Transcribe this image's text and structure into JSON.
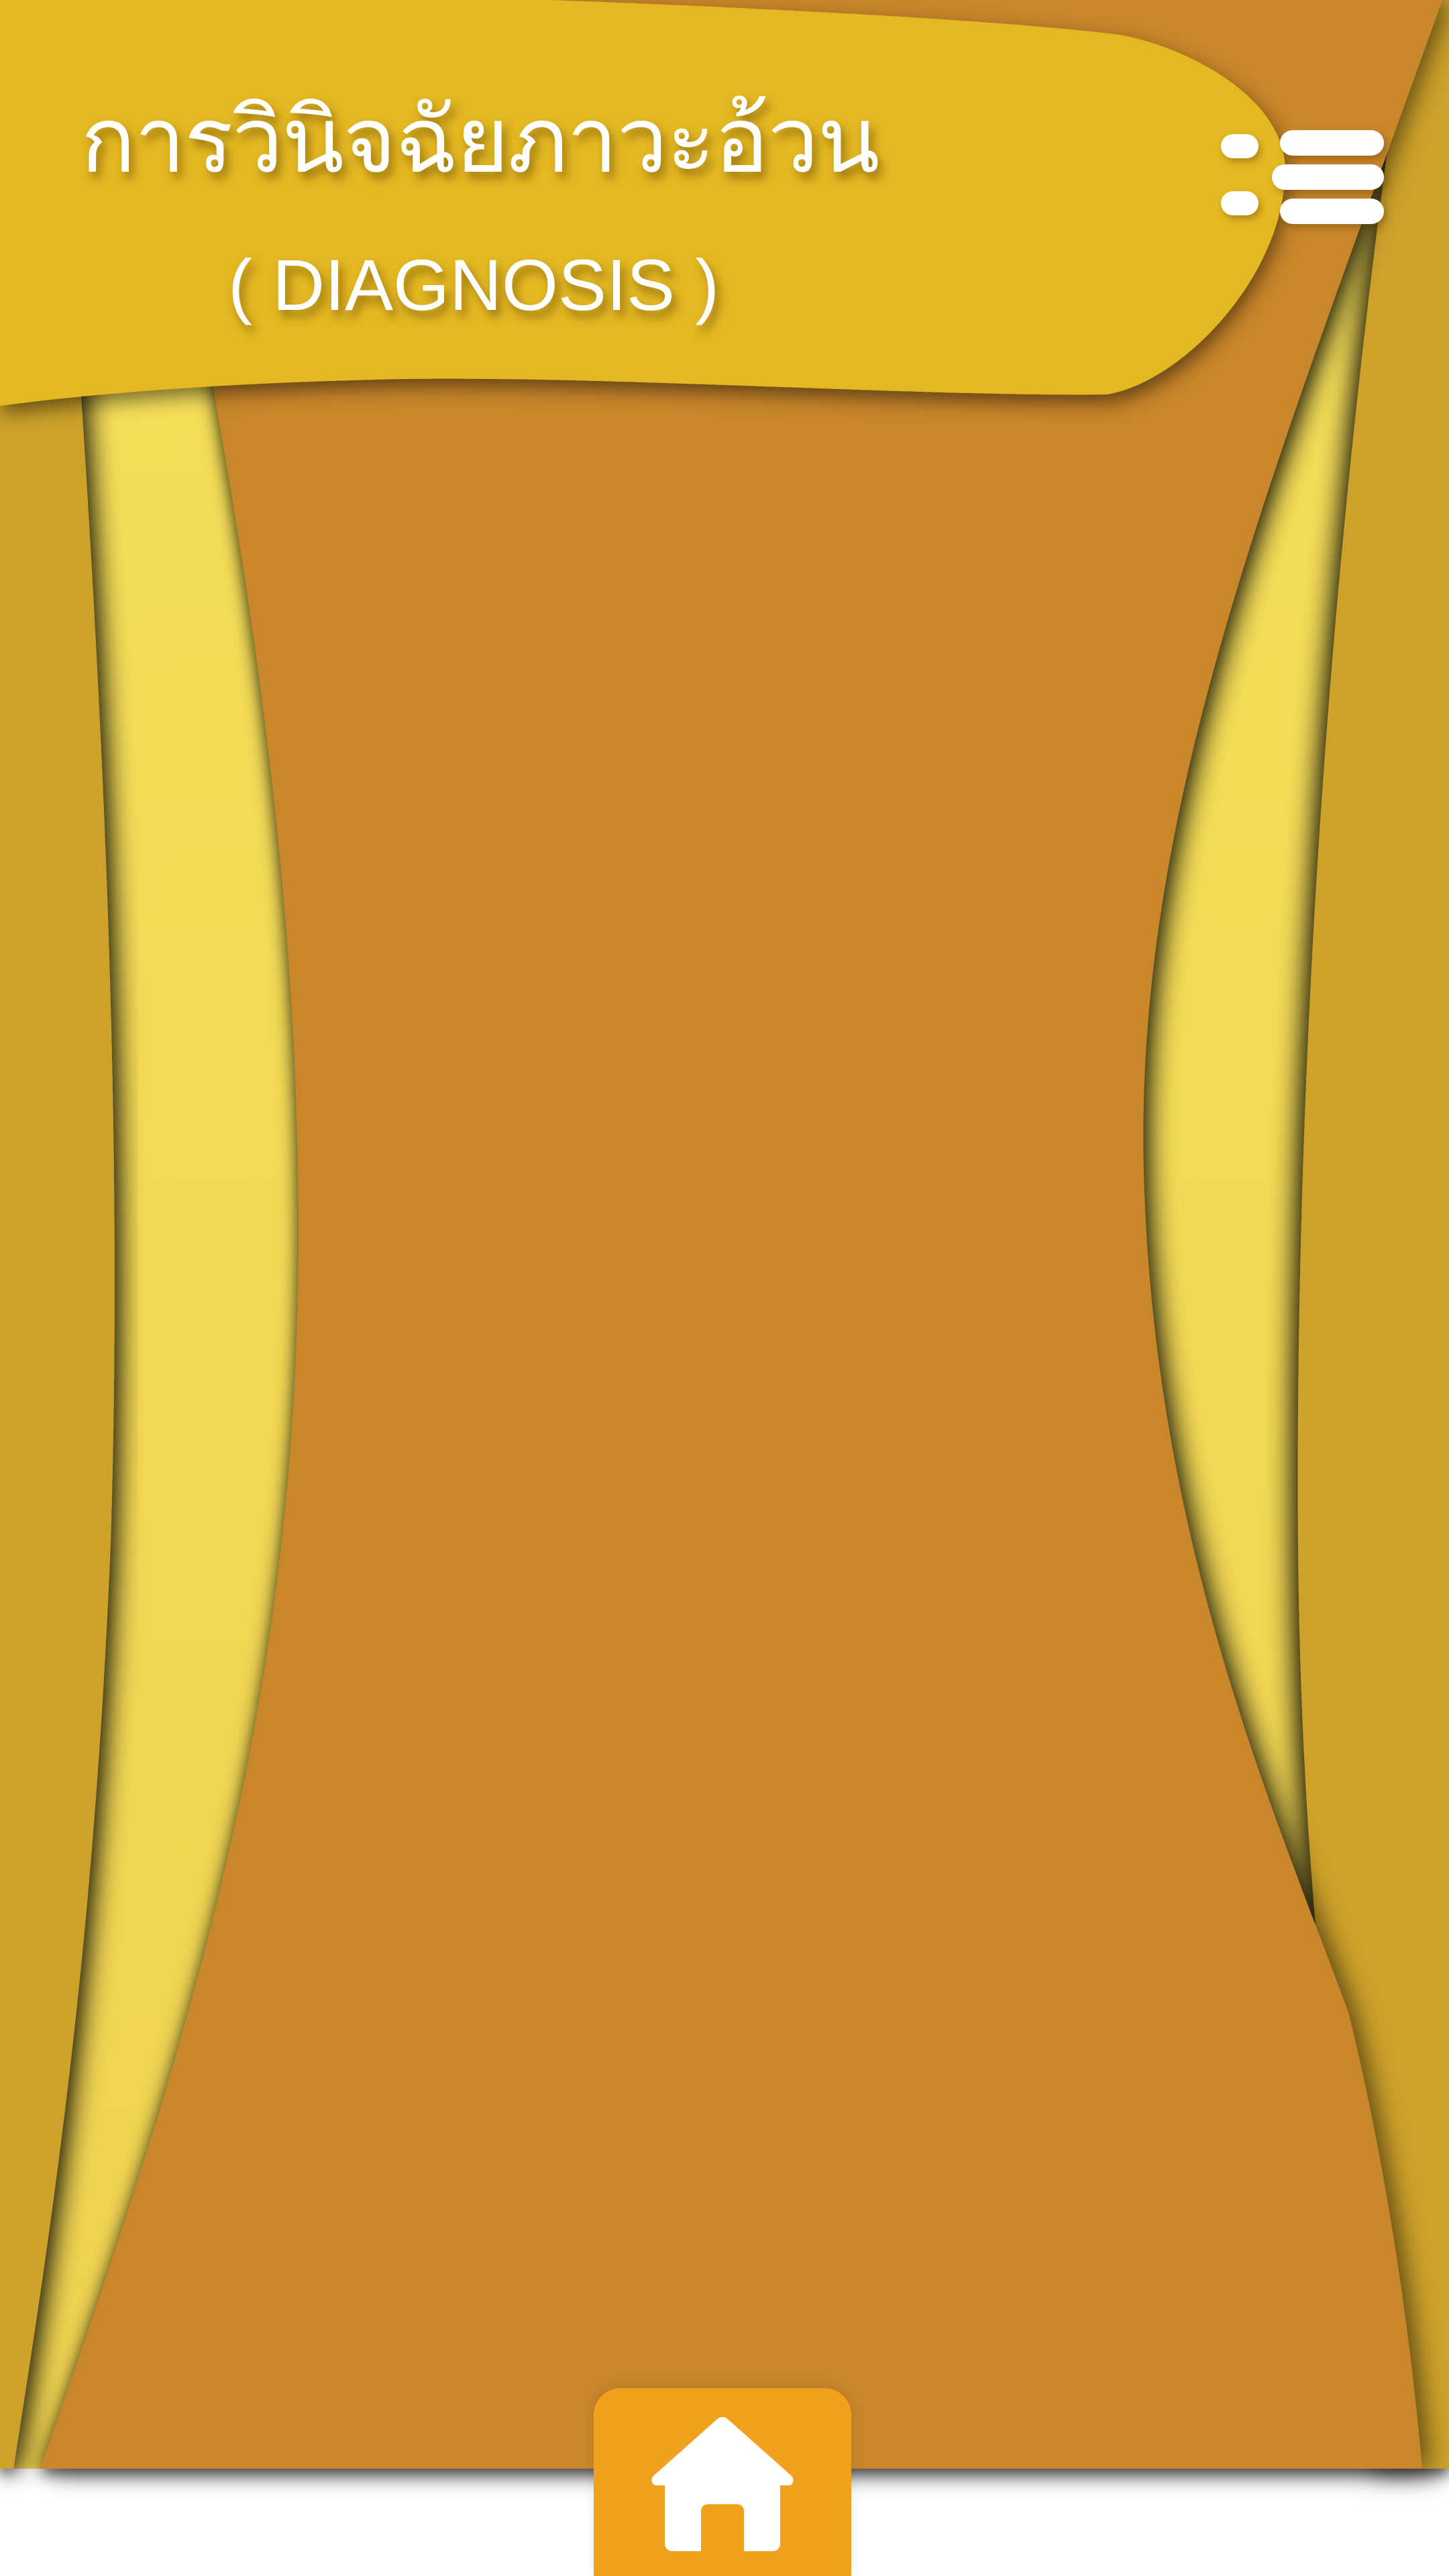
{
  "header": {
    "title_thai": "การวินิจฉัยภาวะอ้วน",
    "title_english": "( DIAGNOSIS )"
  },
  "icons": {
    "menu": "list-menu-icon",
    "home": "home-icon"
  },
  "colors": {
    "header_yellow": "#e4b824",
    "center_orange": "#c98629",
    "mid_gold": "#cda12a",
    "outer_yellow": "#f4de56",
    "home_tab_orange": "#f0a21e"
  }
}
